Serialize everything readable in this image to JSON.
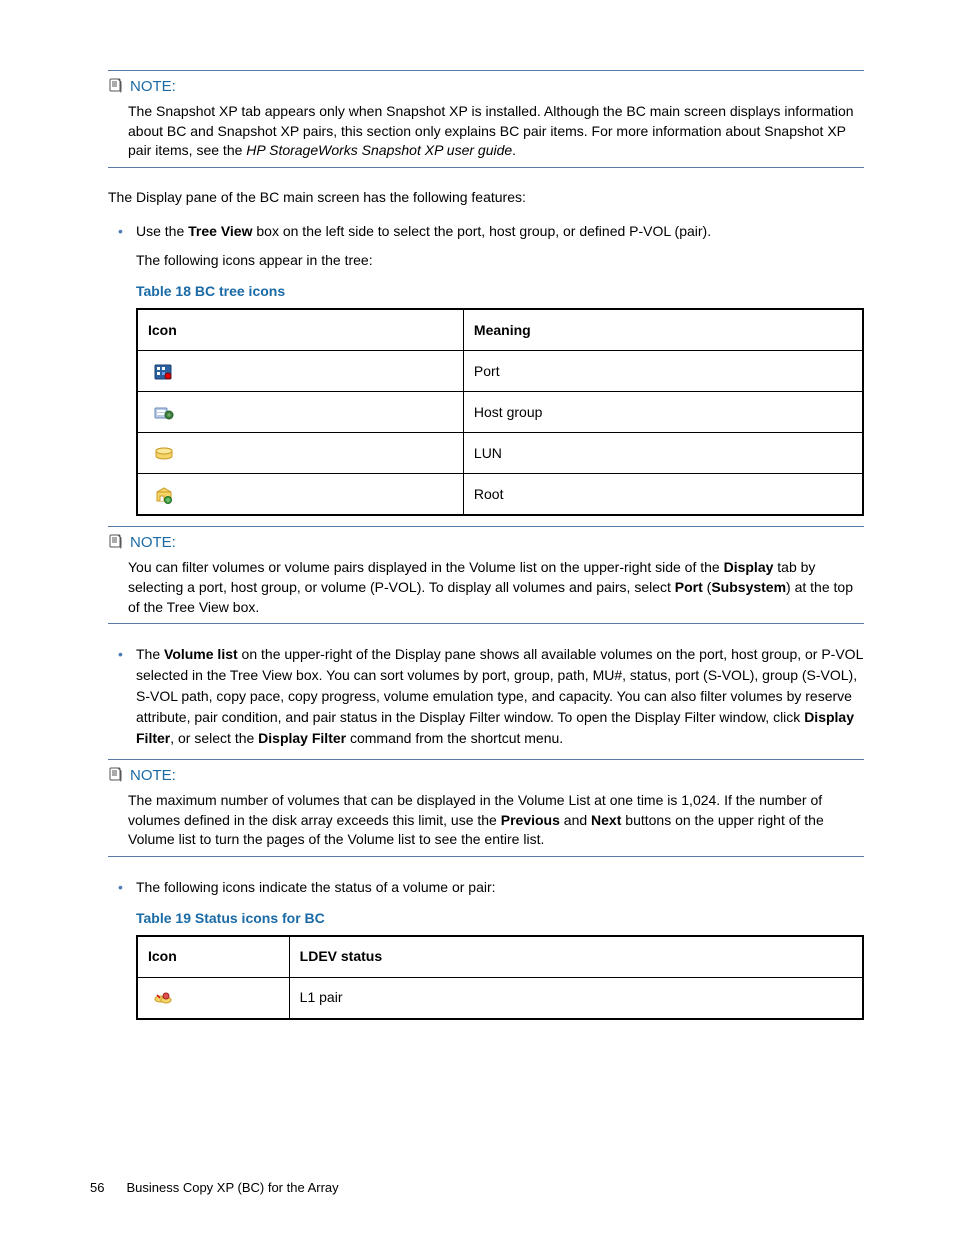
{
  "notes": {
    "label": "NOTE:",
    "n1": "The Snapshot XP tab appears only when Snapshot XP is installed. Although the BC main screen displays information about BC and Snapshot XP pairs, this section only explains BC pair items. For more information about Snapshot XP pair items, see the ",
    "n1_italic": "HP StorageWorks Snapshot XP user guide",
    "n1_tail": ".",
    "n2_a": "You can filter volumes or volume pairs displayed in the Volume list on the upper-right side of the ",
    "n2_b": "Display",
    "n2_c": " tab by selecting a port, host group, or volume (P-VOL). To display all volumes and pairs, select ",
    "n2_d": "Port",
    "n2_e": " (",
    "n2_f": "Subsystem",
    "n2_g": ") at the top of the Tree View box.",
    "n3_a": "The maximum number of volumes that can be displayed in the Volume List at one time is 1,024. If the number of volumes defined in the disk array exceeds this limit, use the ",
    "n3_b": "Previous",
    "n3_c": " and ",
    "n3_d": "Next",
    "n3_e": " buttons on the upper right of the Volume list to turn the pages of the Volume list to see the entire list."
  },
  "para1": "The Display pane of the BC main screen has the following features:",
  "bullets": {
    "b1_a": "Use the ",
    "b1_b": "Tree View",
    "b1_c": " box on the left side to select the port, host group, or defined P-VOL (pair).",
    "b1_sub": "The following icons appear in the tree:",
    "b2_a": "The ",
    "b2_b": "Volume list",
    "b2_c": " on the upper-right of the Display pane shows all available volumes on the port, host group, or P-VOL selected in the Tree View box. You can sort volumes by port, group, path, MU#, status, port (S-VOL), group (S-VOL), S-VOL path, copy pace, copy progress, volume emulation type, and capacity. You can also filter volumes by reserve attribute, pair condition, and pair status in the Display Filter window. To open the Display Filter window, click ",
    "b2_d": "Display Filter",
    "b2_e": ", or select the ",
    "b2_f": "Display Filter",
    "b2_g": " command from the shortcut menu.",
    "b3": "The following icons indicate the status of a volume or pair:"
  },
  "table1": {
    "caption": "Table 18 BC tree icons",
    "h1": "Icon",
    "h2": "Meaning",
    "rows": [
      {
        "meaning": "Port"
      },
      {
        "meaning": "Host group"
      },
      {
        "meaning": "LUN"
      },
      {
        "meaning": "Root"
      }
    ]
  },
  "table2": {
    "caption": "Table 19 Status icons for BC",
    "h1": "Icon",
    "h2": "LDEV status",
    "rows": [
      {
        "status": "L1 pair"
      }
    ]
  },
  "footer": {
    "page": "56",
    "title": "Business Copy XP (BC) for the Array"
  }
}
